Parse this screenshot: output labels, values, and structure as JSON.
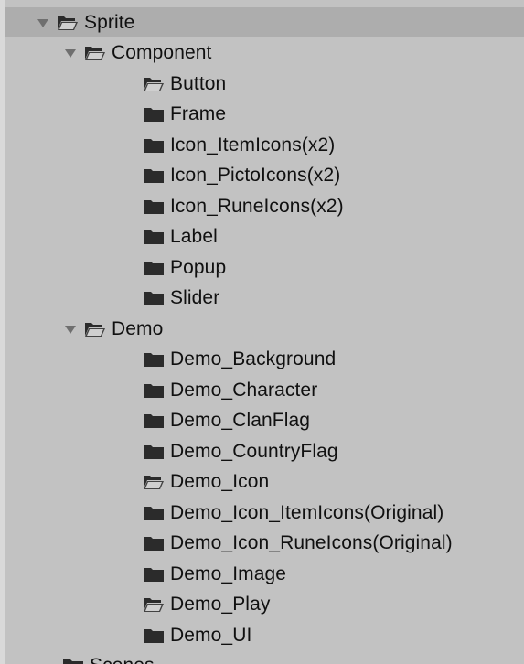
{
  "tree": {
    "rows": [
      {
        "label": "Sprite",
        "indent": 0,
        "expanded": true,
        "folder": "open",
        "selected": true
      },
      {
        "label": "Component",
        "indent": 1,
        "expanded": true,
        "folder": "open"
      },
      {
        "label": "Button",
        "indent": 2,
        "folder": "open"
      },
      {
        "label": "Frame",
        "indent": 2,
        "folder": "closed"
      },
      {
        "label": "Icon_ItemIcons(x2)",
        "indent": 2,
        "folder": "closed"
      },
      {
        "label": "Icon_PictoIcons(x2)",
        "indent": 2,
        "folder": "closed"
      },
      {
        "label": "Icon_RuneIcons(x2)",
        "indent": 2,
        "folder": "closed"
      },
      {
        "label": "Label",
        "indent": 2,
        "folder": "closed"
      },
      {
        "label": "Popup",
        "indent": 2,
        "folder": "closed"
      },
      {
        "label": "Slider",
        "indent": 2,
        "folder": "closed"
      },
      {
        "label": "Demo",
        "indent": 1,
        "expanded": true,
        "folder": "open"
      },
      {
        "label": "Demo_Background",
        "indent": 2,
        "folder": "closed"
      },
      {
        "label": "Demo_Character",
        "indent": 2,
        "folder": "closed"
      },
      {
        "label": "Demo_ClanFlag",
        "indent": 2,
        "folder": "closed"
      },
      {
        "label": "Demo_CountryFlag",
        "indent": 2,
        "folder": "closed"
      },
      {
        "label": "Demo_Icon",
        "indent": 2,
        "folder": "open"
      },
      {
        "label": "Demo_Icon_ItemIcons(Original)",
        "indent": 2,
        "folder": "closed"
      },
      {
        "label": "Demo_Icon_RuneIcons(Original)",
        "indent": 2,
        "folder": "closed"
      },
      {
        "label": "Demo_Image",
        "indent": 2,
        "folder": "closed"
      },
      {
        "label": "Demo_Play",
        "indent": 2,
        "folder": "open"
      },
      {
        "label": "Demo_UI",
        "indent": 2,
        "folder": "closed"
      },
      {
        "label": "Scenes",
        "indent": 0,
        "folder": "closed",
        "partial": true
      }
    ]
  },
  "colors": {
    "background": "#c2c2c2",
    "selected_row": "#adadad",
    "text": "#101010",
    "folder": "#2b2b2b",
    "arrow": "#6f6f6f"
  }
}
